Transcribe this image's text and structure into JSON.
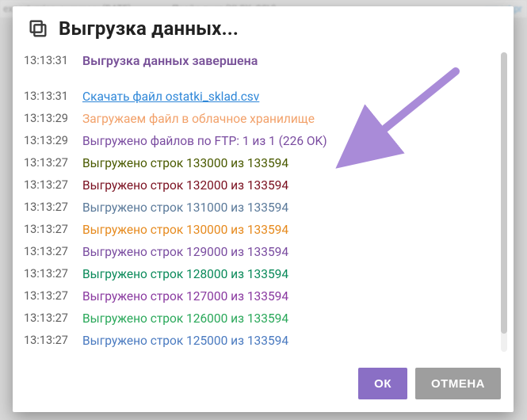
{
  "background": {
    "row1_left": "export_price_summary (DATE)",
    "row1_mid": "Прайс-лист (XLSX, CSV)",
    "row1_right": "export pr"
  },
  "modal": {
    "title": "Выгрузка данных...",
    "buttons": {
      "ok": "ОК",
      "cancel": "ОТМЕНА"
    }
  },
  "log": [
    {
      "time": "13:13:31",
      "msg": "Выгрузка данных завершена",
      "cls": "c-head",
      "first": true
    },
    {
      "time": "13:13:31",
      "msg": "Скачать файл ostatki_sklad.csv",
      "cls": "c-link",
      "link": true
    },
    {
      "time": "13:13:29",
      "msg": "Загружаем файл в облачное хранилище",
      "cls": "c-orange"
    },
    {
      "time": "13:13:29",
      "msg": "Выгружено файлов по FTP: 1 из 1 (226 OK)",
      "cls": "c-purple"
    },
    {
      "time": "13:13:27",
      "msg": "Выгружено строк 133000 из 133594",
      "cls": "c-olive"
    },
    {
      "time": "13:13:27",
      "msg": "Выгружено строк 132000 из 133594",
      "cls": "c-darkred"
    },
    {
      "time": "13:13:27",
      "msg": "Выгружено строк 131000 из 133594",
      "cls": "c-steel"
    },
    {
      "time": "13:13:27",
      "msg": "Выгружено строк 130000 из 133594",
      "cls": "c-orange2"
    },
    {
      "time": "13:13:27",
      "msg": "Выгружено строк 129000 из 133594",
      "cls": "c-purple2"
    },
    {
      "time": "13:13:27",
      "msg": "Выгружено строк 128000 из 133594",
      "cls": "c-teal"
    },
    {
      "time": "13:13:27",
      "msg": "Выгружено строк 127000 из 133594",
      "cls": "c-violet"
    },
    {
      "time": "13:13:27",
      "msg": "Выгружено строк 126000 из 133594",
      "cls": "c-green"
    },
    {
      "time": "13:13:27",
      "msg": "Выгружено строк 125000 из 133594",
      "cls": "c-blue"
    }
  ]
}
